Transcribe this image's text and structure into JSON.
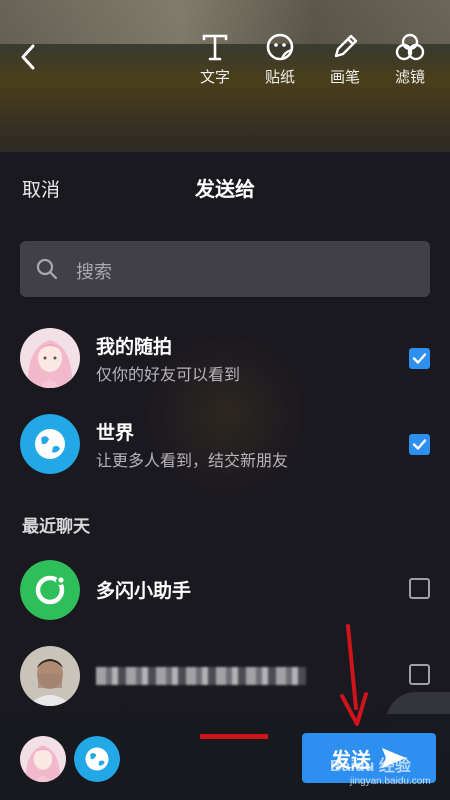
{
  "toolbar": {
    "tools": [
      {
        "label": "文字",
        "icon": "text-icon"
      },
      {
        "label": "贴纸",
        "icon": "sticker-icon"
      },
      {
        "label": "画笔",
        "icon": "pen-icon"
      },
      {
        "label": "滤镜",
        "icon": "filter-icon"
      }
    ]
  },
  "sheet": {
    "cancel_label": "取消",
    "title": "发送给",
    "search_placeholder": "搜索"
  },
  "targets": [
    {
      "name": "我的随拍",
      "subtitle": "仅你的好友可以看到",
      "checked": true
    },
    {
      "name": "世界",
      "subtitle": "让更多人看到，结交新朋友",
      "checked": true
    }
  ],
  "recent": {
    "section_title": "最近聊天",
    "items": [
      {
        "name": "多闪小助手",
        "checked": false
      },
      {
        "name": "",
        "checked": false
      }
    ]
  },
  "bottom": {
    "send_label": "发送"
  },
  "watermark": {
    "text": "Baidu 经验",
    "url": "jingyan.baidu.com"
  },
  "colors": {
    "accent": "#2d8ff0",
    "assistant_green": "#2fbf5a",
    "world_blue": "#22a8e6",
    "annotation_red": "#d0141c"
  }
}
